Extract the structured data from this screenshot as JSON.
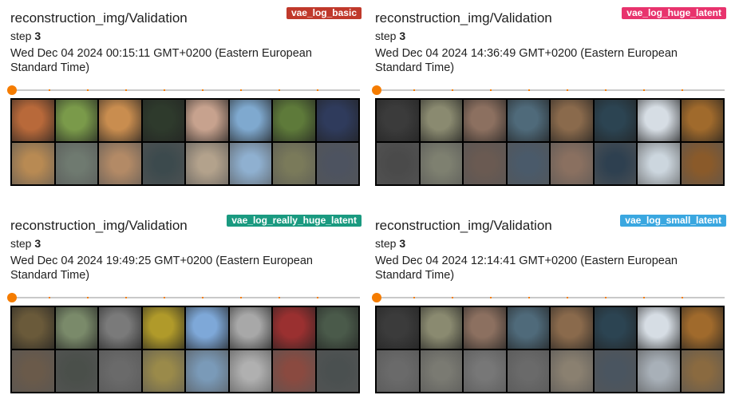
{
  "cards": [
    {
      "title": "reconstruction_img/Validation",
      "run": "vae_log_basic",
      "run_color": "#c0392b",
      "step_label": "step",
      "step": "3",
      "timestamp": "Wed Dec 04 2024 00:15:11 GMT+0200 (Eastern European Standard Time)",
      "images_top": [
        "#b8693a",
        "#7a9a4a",
        "#c98d4f",
        "#2e3a2c",
        "#c7a28e",
        "#7fa9cf",
        "#5e7a3a",
        "#2f3b5c"
      ],
      "images_bottom": [
        "#b88a53",
        "#6f7a70",
        "#b38a66",
        "#3c4a4d",
        "#b3a28c",
        "#8fb0d0",
        "#7a7a5a",
        "#4d5360"
      ]
    },
    {
      "title": "reconstruction_img/Validation",
      "run": "vae_log_huge_latent",
      "run_color": "#e8336d",
      "step_label": "step",
      "step": "3",
      "timestamp": "Wed Dec 04 2024 14:36:49 GMT+0200 (Eastern European Standard Time)",
      "images_top": [
        "#3b3b3b",
        "#8a8a70",
        "#8c7060",
        "#4f6a7a",
        "#8a6a4c",
        "#2c4452",
        "#d6dde4",
        "#a06a2c"
      ],
      "images_bottom": [
        "#4a4a4a",
        "#7e8070",
        "#6a5a52",
        "#4a5a6a",
        "#8a7060",
        "#2e4050",
        "#ccd6de",
        "#8a5a2a"
      ]
    },
    {
      "title": "reconstruction_img/Validation",
      "run": "vae_log_really_huge_latent",
      "run_color": "#1a9a80",
      "step_label": "step",
      "step": "3",
      "timestamp": "Wed Dec 04 2024 19:49:25 GMT+0200 (Eastern European Standard Time)",
      "images_top": [
        "#6a5a3a",
        "#7a8a6a",
        "#7a7a7a",
        "#b09a2a",
        "#7ea8d8",
        "#a8a8a8",
        "#9a3030",
        "#4a5a4a"
      ],
      "images_bottom": [
        "#6a5a4a",
        "#4a4f4a",
        "#6a6a6a",
        "#9a8a4a",
        "#7a9ab8",
        "#b0b0b0",
        "#8a4a40",
        "#4a5050"
      ]
    },
    {
      "title": "reconstruction_img/Validation",
      "run": "vae_log_small_latent",
      "run_color": "#3aa7e0",
      "step_label": "step",
      "step": "3",
      "timestamp": "Wed Dec 04 2024 12:14:41 GMT+0200 (Eastern European Standard Time)",
      "images_top": [
        "#3b3b3b",
        "#8a8a70",
        "#8c7060",
        "#4f6a7a",
        "#8a6a4c",
        "#2c4452",
        "#d6dde4",
        "#a06a2c"
      ],
      "images_bottom": [
        "#6a6a6a",
        "#7a7a72",
        "#777777",
        "#6a6a6a",
        "#8a8070",
        "#4a5560",
        "#a8b0b8",
        "#8a6a40"
      ]
    }
  ]
}
